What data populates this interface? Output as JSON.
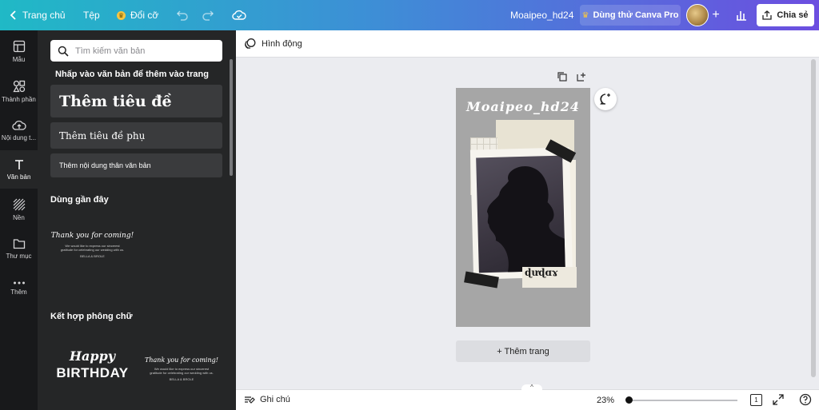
{
  "topbar": {
    "home_label": "Trang chủ",
    "file_label": "Tệp",
    "resize_label": "Đổi cỡ",
    "doc_title": "Moaipeo_hd24",
    "pro_label": "Dùng thử Canva Pro",
    "share_label": "Chia sẻ"
  },
  "rail": {
    "items": [
      {
        "label": "Mẫu",
        "icon": "layout-icon"
      },
      {
        "label": "Thành phần",
        "icon": "shapes-icon"
      },
      {
        "label": "Nội dung t...",
        "icon": "cloud-upload-icon"
      },
      {
        "label": "Văn bản",
        "icon": "text-t-icon"
      },
      {
        "label": "Nền",
        "icon": "hatch-icon"
      },
      {
        "label": "Thư mục",
        "icon": "folder-icon"
      },
      {
        "label": "Thêm",
        "icon": "more-dots-icon"
      }
    ]
  },
  "panel": {
    "search_placeholder": "Tìm kiếm văn bản",
    "click_hint": "Nhấp vào văn bản để thêm vào trang",
    "add_heading": "Thêm tiêu đề",
    "add_subheading": "Thêm tiêu đề phụ",
    "add_body": "Thêm nội dung thân văn bản",
    "recent_heading": "Dùng gần đây",
    "combos_heading": "Kết hợp phông chữ",
    "recent_sample": {
      "script": "Thank you for coming!",
      "line1": "We would like to express our sincerest",
      "line2": "gratitude for celebrating our wedding with us.",
      "sign": "BELLA & BROLE"
    },
    "combo_happy": "Happy",
    "combo_birthday": "BIRTHDAY"
  },
  "toolbar2": {
    "animate_label": "Hình động"
  },
  "page": {
    "title": "Moaipeo_hd24",
    "sticker_text": "ɖưɖɑɤ"
  },
  "add_page_label": "+ Thêm trang",
  "footer": {
    "notes_label": "Ghi chú",
    "zoom": "23%",
    "zoom_value": 0.0,
    "page_count": "1"
  },
  "colors": {
    "topbar_start": "#20b9c6",
    "topbar_end": "#6c4ee0",
    "panel_bg": "#252627",
    "rail_bg": "#18191b",
    "page_bg": "#a6a6a6",
    "pro_crown": "#f5c542"
  }
}
